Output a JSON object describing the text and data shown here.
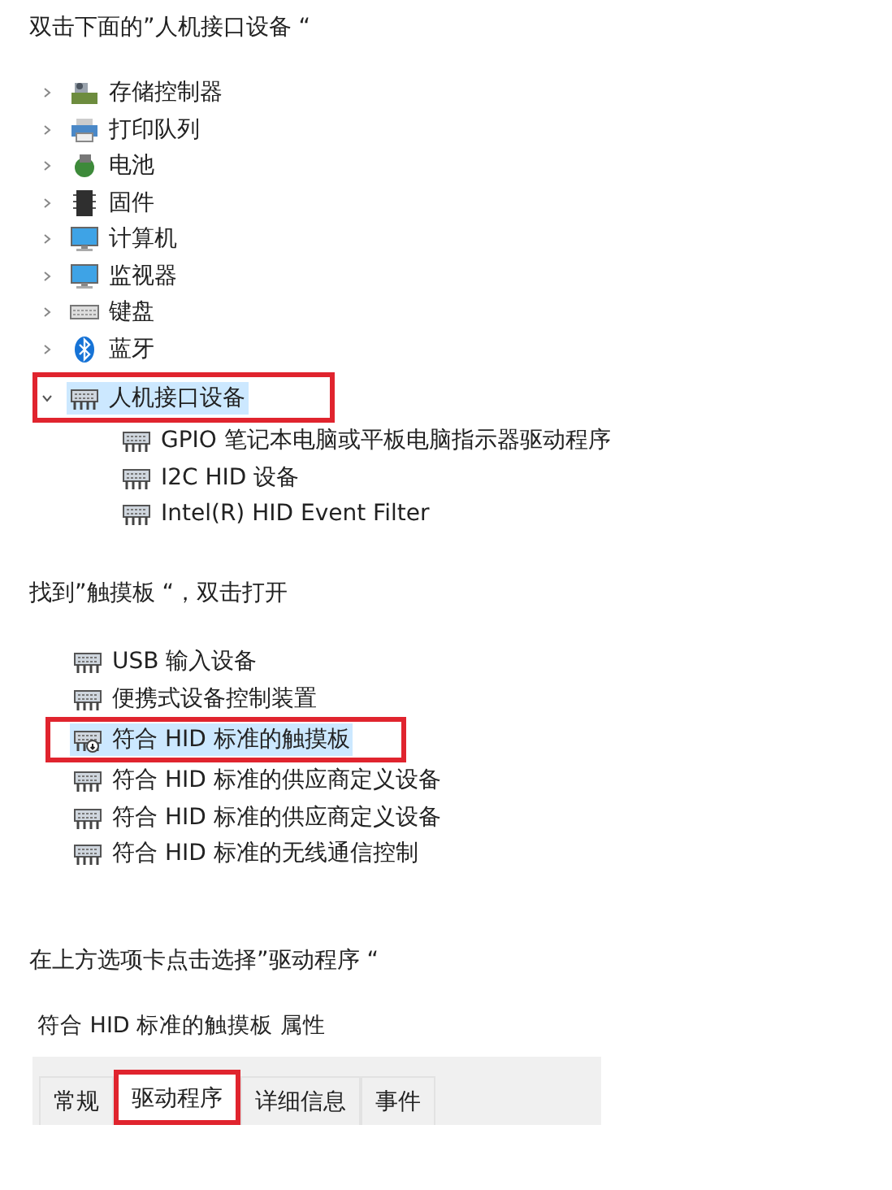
{
  "steps": [
    {
      "instruction": "双击下面的”人机接口设备 “",
      "kind": "tree",
      "tree": [
        {
          "label": "存储控制器",
          "kind": "storage",
          "expanded": false,
          "selected": false,
          "marked": false
        },
        {
          "label": "打印队列",
          "kind": "printer",
          "expanded": false,
          "selected": false,
          "marked": false
        },
        {
          "label": "电池",
          "kind": "battery",
          "expanded": false,
          "selected": false,
          "marked": false
        },
        {
          "label": "固件",
          "kind": "chip",
          "expanded": false,
          "selected": false,
          "marked": false
        },
        {
          "label": "计算机",
          "kind": "computer",
          "expanded": false,
          "selected": false,
          "marked": false
        },
        {
          "label": "监视器",
          "kind": "monitor",
          "expanded": false,
          "selected": false,
          "marked": false
        },
        {
          "label": "键盘",
          "kind": "keyboard",
          "expanded": false,
          "selected": false,
          "marked": false
        },
        {
          "label": "蓝牙",
          "kind": "bluetooth",
          "expanded": false,
          "selected": false,
          "marked": false
        },
        {
          "label": "人机接口设备",
          "kind": "hid",
          "expanded": true,
          "selected": true,
          "marked": true,
          "children": [
            {
              "label": "GPIO 笔记本电脑或平板电脑指示器驱动程序",
              "kind": "hid",
              "selected": false,
              "marked": false
            },
            {
              "label": "I2C HID 设备",
              "kind": "hid",
              "selected": false,
              "marked": false
            },
            {
              "label": "Intel(R) HID Event Filter",
              "kind": "hid",
              "selected": false,
              "marked": false
            }
          ]
        }
      ]
    },
    {
      "instruction": "找到”触摸板 “，双击打开",
      "kind": "list",
      "items": [
        {
          "label": "USB 输入设备",
          "kind": "hid",
          "selected": false,
          "marked": false
        },
        {
          "label": "便携式设备控制装置",
          "kind": "hid",
          "selected": false,
          "marked": false
        },
        {
          "label": "符合 HID 标准的触摸板",
          "kind": "touchpad",
          "selected": true,
          "marked": true
        },
        {
          "label": "符合 HID 标准的供应商定义设备",
          "kind": "hid",
          "selected": false,
          "marked": false
        },
        {
          "label": "符合 HID 标准的供应商定义设备",
          "kind": "hid",
          "selected": false,
          "marked": false
        },
        {
          "label": "符合 HID 标准的无线通信控制",
          "kind": "hid",
          "selected": false,
          "marked": false
        }
      ]
    },
    {
      "instruction": "在上方选项卡点击选择”驱动程序 “",
      "kind": "dialog",
      "dialog": {
        "title": "符合 HID 标准的触摸板 属性",
        "tabs": [
          {
            "label": "常规",
            "selected": false,
            "marked": false
          },
          {
            "label": "驱动程序",
            "selected": true,
            "marked": true
          },
          {
            "label": "详细信息",
            "selected": false,
            "marked": false
          },
          {
            "label": "事件",
            "selected": false,
            "marked": false
          }
        ]
      }
    }
  ]
}
